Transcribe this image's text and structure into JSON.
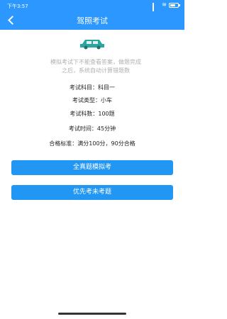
{
  "status_bar": {
    "time": "下午3:57"
  },
  "header": {
    "title": "驾照考试"
  },
  "notice": {
    "line1": "模拟考试下不能查看答案，做题完成",
    "line2": "之后，系统自动计算错题数"
  },
  "info": {
    "subject_label": "考试科目：",
    "subject_value": "科目一",
    "type_label": "考试类型：",
    "type_value": "小车",
    "count_label": "考试科数：",
    "count_value": "100题",
    "time_label": "考试时间：",
    "time_value": "45分钟",
    "standard_label": "合格标准：",
    "standard_value": "满分100分，90分合格"
  },
  "buttons": {
    "full": "全真题模拟考",
    "unanswered": "优先考未考题"
  },
  "colors": {
    "primary": "#2b97ff",
    "button": "#2196f3",
    "car": "#2aa5a0"
  }
}
